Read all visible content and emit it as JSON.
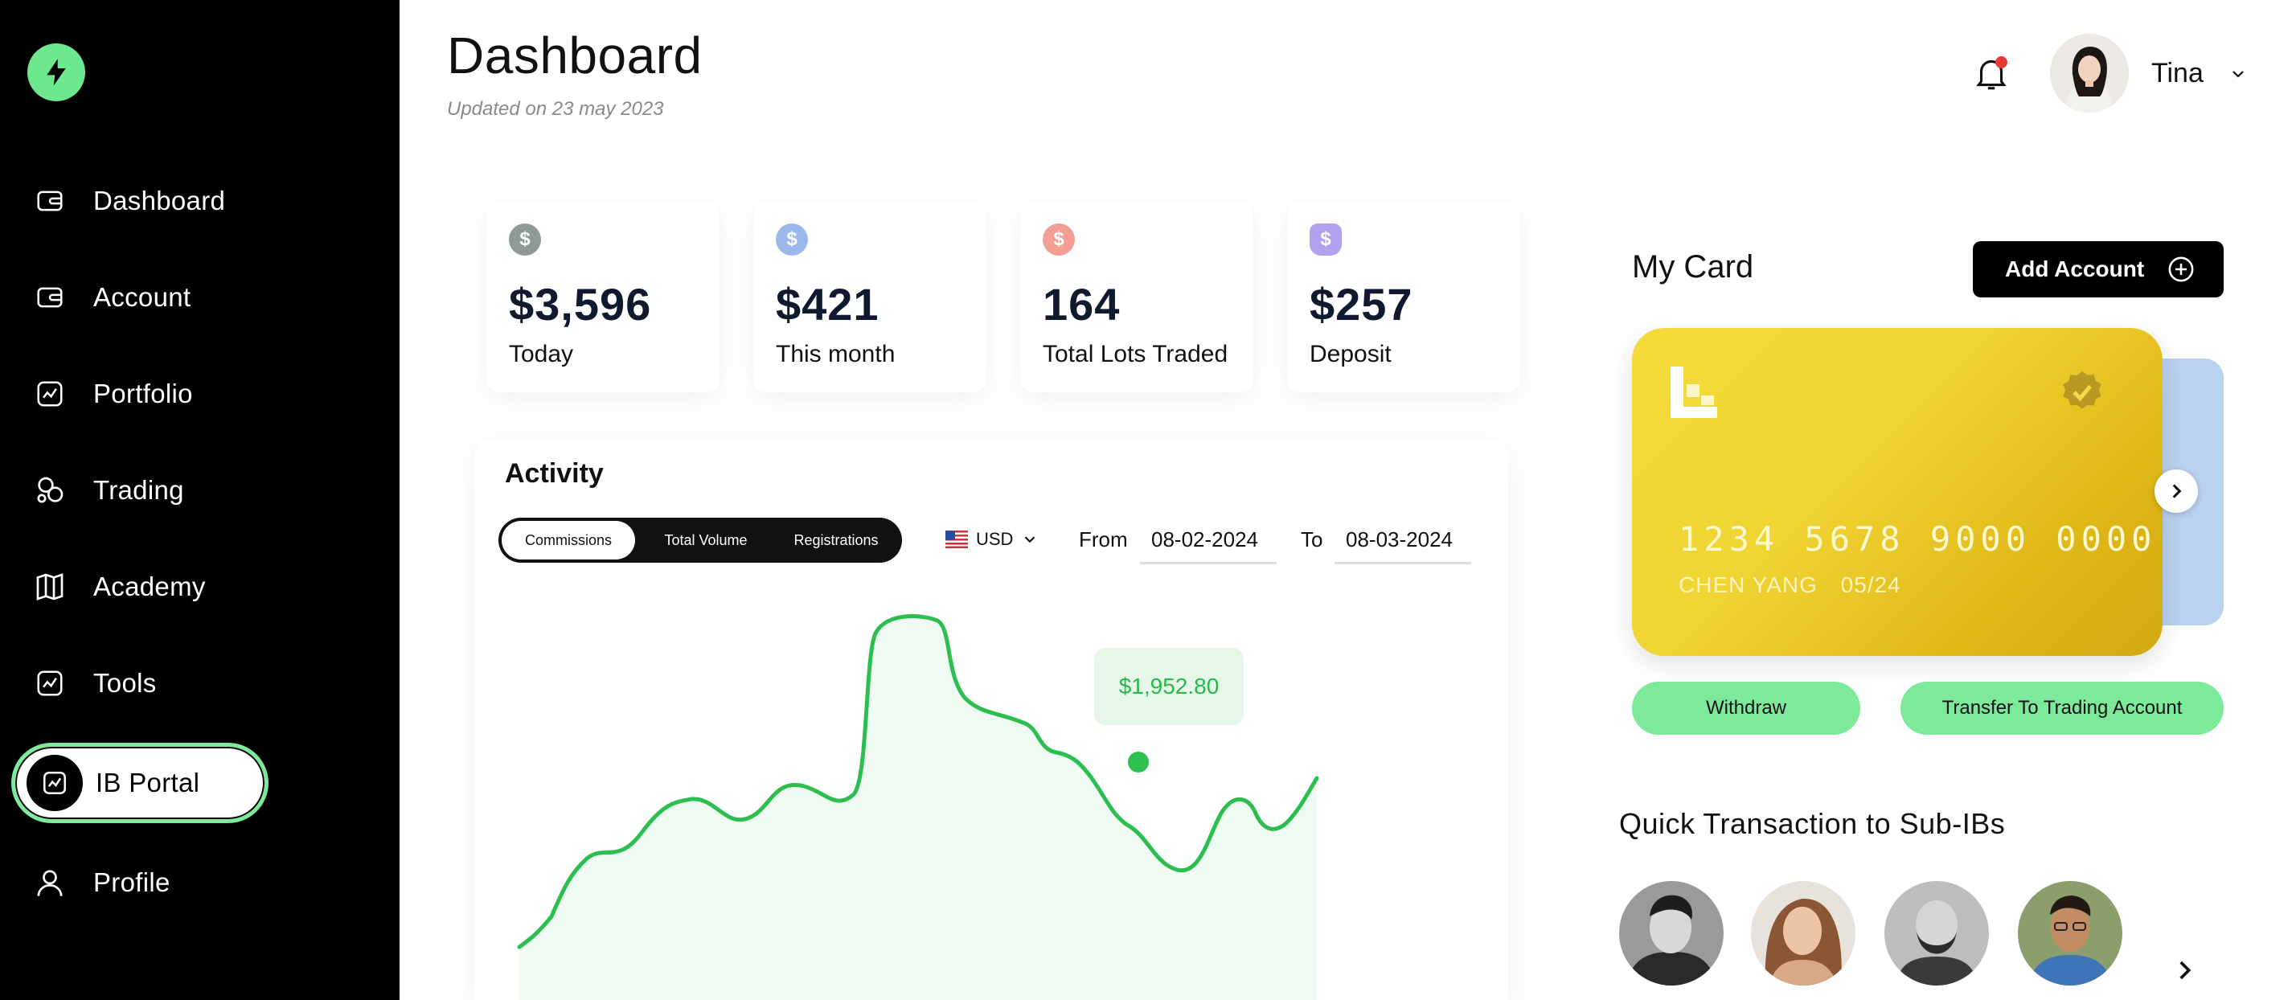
{
  "sidebar": {
    "items": [
      {
        "label": "Dashboard",
        "icon": "wallet-icon"
      },
      {
        "label": "Account",
        "icon": "wallet-icon"
      },
      {
        "label": "Portfolio",
        "icon": "chart-line-icon"
      },
      {
        "label": "Trading",
        "icon": "trading-icon"
      },
      {
        "label": "Academy",
        "icon": "book-icon"
      },
      {
        "label": "Tools",
        "icon": "chart-line-icon"
      },
      {
        "label": "IB Portal",
        "icon": "chart-line-icon"
      },
      {
        "label": "Profile",
        "icon": "user-icon"
      }
    ],
    "active": "IB Portal"
  },
  "header": {
    "title": "Dashboard",
    "updated": "Updated on 23 may 2023",
    "user_name": "Tina"
  },
  "stats": [
    {
      "value": "$3,596",
      "label": "Today",
      "icon": "dollar-icon",
      "color": "#8e9a95"
    },
    {
      "value": "$421",
      "label": "This month",
      "icon": "dollar-up-icon",
      "color": "#9bb8ea"
    },
    {
      "value": "164",
      "label": "Total Lots Traded",
      "icon": "dollar-up-icon",
      "color": "#f39f94"
    },
    {
      "value": "$257",
      "label": "Deposit",
      "icon": "money-bag-icon",
      "color": "#b3a0ee"
    }
  ],
  "activity": {
    "title": "Activity",
    "tabs": [
      "Commissions",
      "Total Volume",
      "Registrations"
    ],
    "active_tab": "Commissions",
    "currency": "USD",
    "from_label": "From",
    "from_value": "08-02-2024",
    "to_label": "To",
    "to_value": "08-03-2024",
    "tooltip": "$1,952.80",
    "line_color": "#2cbf4f"
  },
  "my_card": {
    "title": "My Card",
    "add_account": "Add Account",
    "card_number": "1234 5678 9000 0000",
    "card_holder": "CHEN YANG",
    "card_expiry": "05/24",
    "withdraw": "Withdraw",
    "transfer": "Transfer To Trading Account"
  },
  "quick": {
    "title": "Quick Transaction to Sub-IBs"
  }
}
